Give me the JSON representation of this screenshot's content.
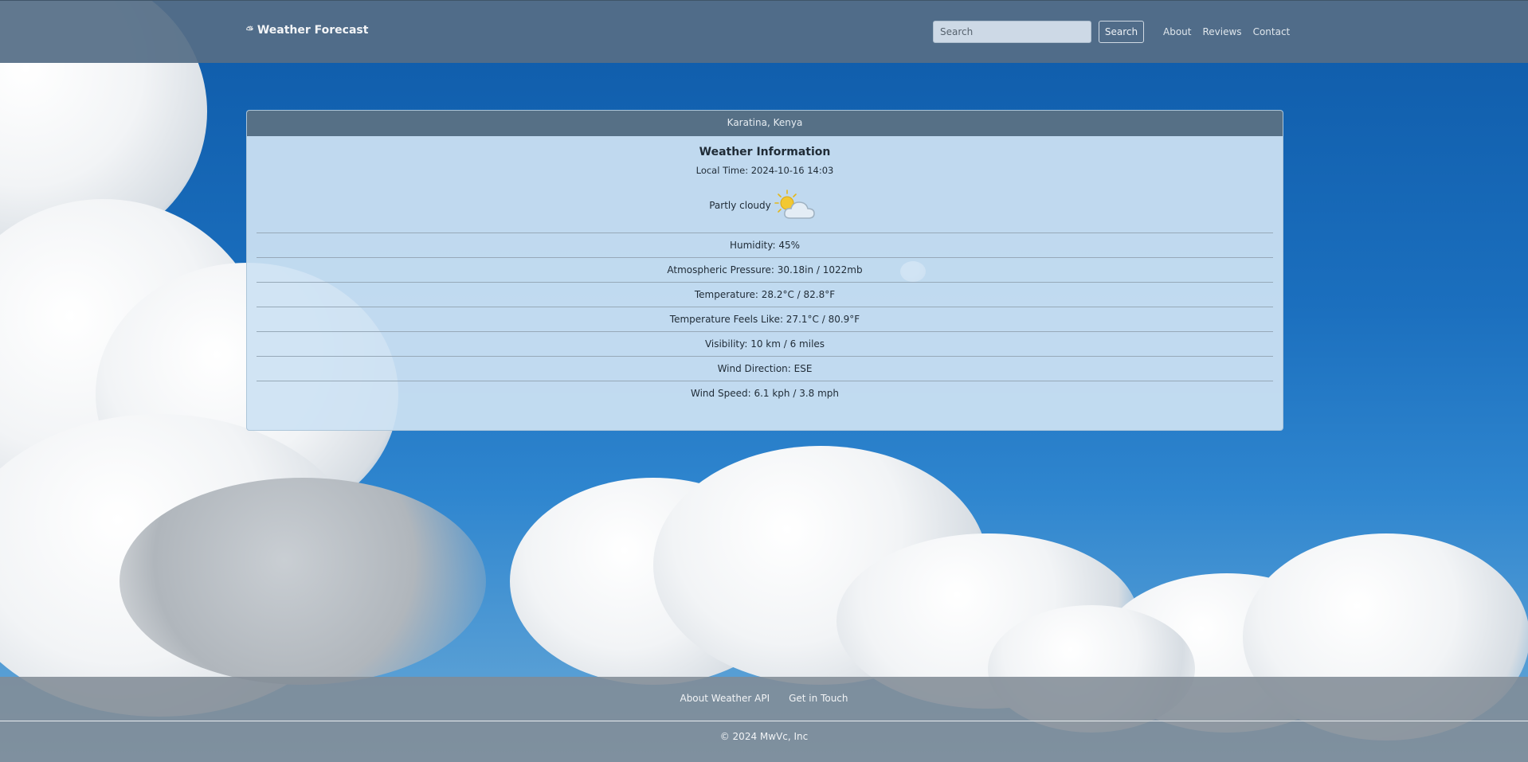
{
  "navbar": {
    "brand": "Weather Forecast",
    "brand_icon": "sunrise-icon",
    "search_placeholder": "Search",
    "search_button": "Search",
    "links": [
      "About",
      "Reviews",
      "Contact"
    ]
  },
  "weather": {
    "location": "Karatina, Kenya",
    "title": "Weather Information",
    "local_time": "Local Time: 2024-10-16 14:03",
    "condition": "Partly cloudy",
    "condition_icon": "partly-cloudy-icon",
    "details": [
      "Humidity: 45%",
      "Atmospheric Pressure: 30.18in / 1022mb",
      "Temperature: 28.2°C / 82.8°F",
      "Temperature Feels Like: 27.1°C / 80.9°F",
      "Visibility: 10 km / 6 miles",
      "Wind Direction: ESE",
      "Wind Speed: 6.1 kph / 3.8 mph"
    ]
  },
  "footer": {
    "links": [
      "About Weather API",
      "Get in Touch"
    ],
    "copyright": "© 2024 MwVc, Inc"
  },
  "colors": {
    "navbar": "#567086",
    "card_bg": "#cee2f3",
    "sky": "#1b6fbe"
  }
}
